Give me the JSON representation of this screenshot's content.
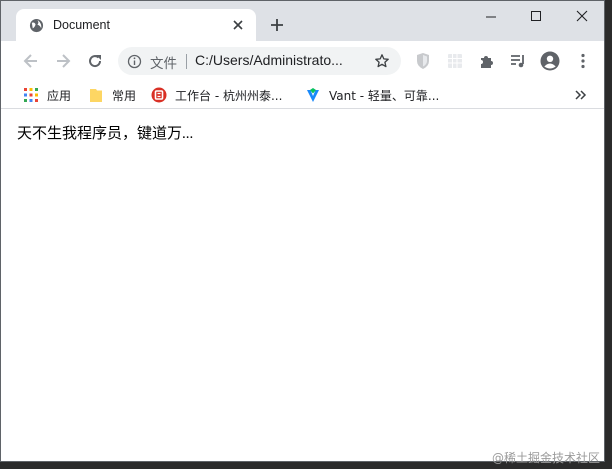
{
  "tab": {
    "title": "Document",
    "favicon": "globe-icon"
  },
  "toolbar": {
    "omnibox_label": "文件",
    "url": "C:/Users/Administrato...",
    "extensions": [
      "shield-extension-icon",
      "grid-extension-icon",
      "puzzle-extensions-icon",
      "media-queue-icon",
      "profile-avatar-icon",
      "more-menu-icon"
    ]
  },
  "bookmarks": {
    "items": [
      {
        "label": "应用",
        "icon": "apps-grid-icon"
      },
      {
        "label": "常用",
        "icon": "folder-icon"
      },
      {
        "label": "工作台 - 杭州州泰...",
        "icon": "red-logo-icon"
      },
      {
        "label": "Vant - 轻量、可靠...",
        "icon": "vant-logo-icon"
      }
    ]
  },
  "page": {
    "text": "天不生我程序员，键道万..."
  },
  "watermark": "@稀土掘金技术社区"
}
